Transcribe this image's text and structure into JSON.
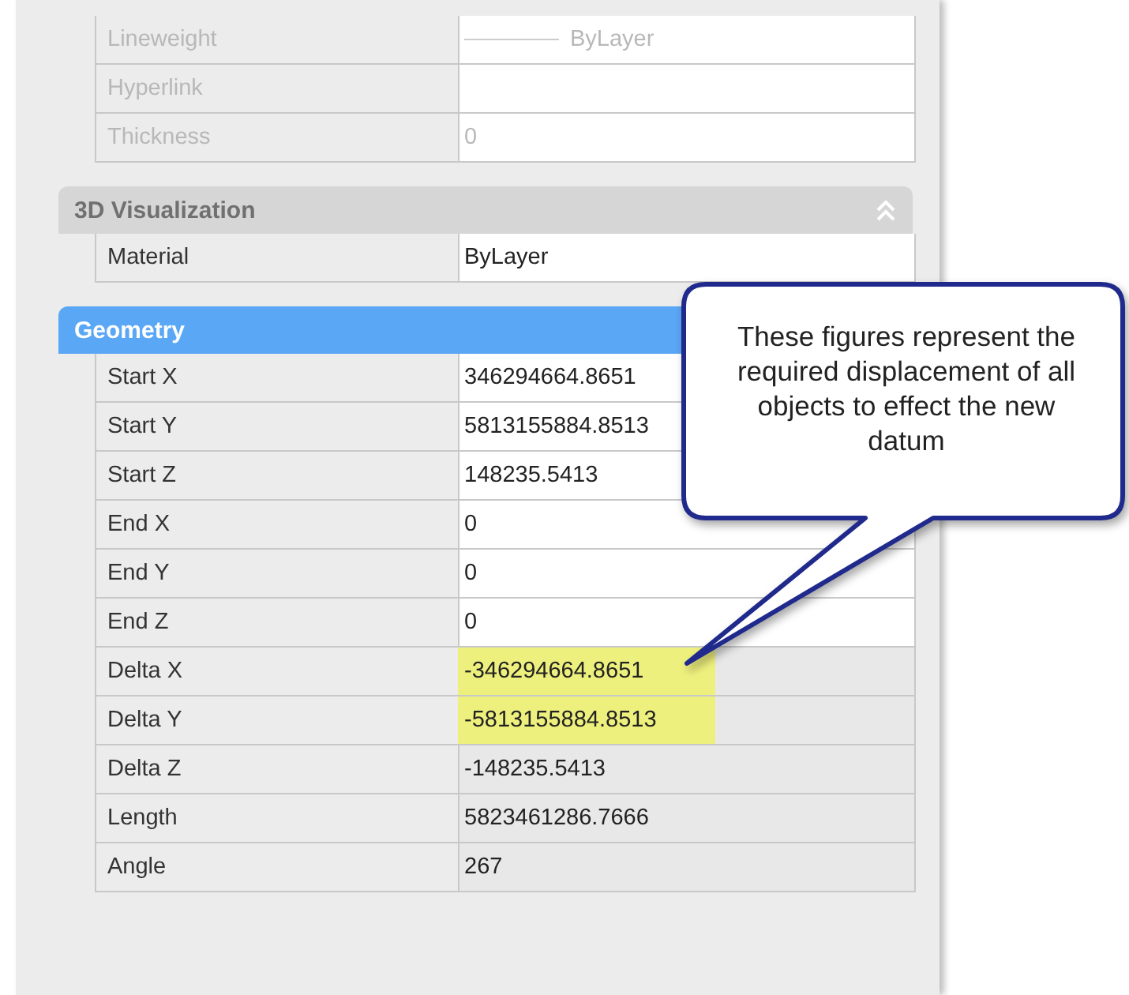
{
  "sections": [
    {
      "rows": [
        {
          "label": "Lineweight",
          "value": "ByLayer",
          "kind": "line",
          "disabled": true,
          "editable": true,
          "highlighted": false
        },
        {
          "label": "Hyperlink",
          "value": null,
          "kind": "text",
          "disabled": true,
          "editable": true,
          "highlighted": false
        },
        {
          "label": "Thickness",
          "value": "0",
          "kind": "text",
          "disabled": true,
          "editable": true,
          "highlighted": false
        }
      ]
    },
    {
      "title": "3D Visualization",
      "selected": false,
      "toggle": true,
      "rows": [
        {
          "label": "Material",
          "value": "ByLayer",
          "kind": "text",
          "disabled": false,
          "editable": true,
          "highlighted": false
        }
      ]
    },
    {
      "title": "Geometry",
      "selected": true,
      "rows": [
        {
          "label": "Start X",
          "value": "346294664.8651",
          "kind": "text",
          "disabled": false,
          "editable": true,
          "highlighted": false
        },
        {
          "label": "Start Y",
          "value": "5813155884.8513",
          "kind": "text",
          "disabled": false,
          "editable": true,
          "highlighted": false
        },
        {
          "label": "Start Z",
          "value": "148235.5413",
          "kind": "text",
          "disabled": false,
          "editable": true,
          "highlighted": false
        },
        {
          "label": "End X",
          "value": "0",
          "kind": "text",
          "disabled": false,
          "editable": true,
          "highlighted": false
        },
        {
          "label": "End Y",
          "value": "0",
          "kind": "text",
          "disabled": false,
          "editable": true,
          "highlighted": false
        },
        {
          "label": "End Z",
          "value": "0",
          "kind": "text",
          "disabled": false,
          "editable": true,
          "highlighted": false
        },
        {
          "label": "Delta X",
          "value": "-346294664.8651",
          "kind": "text",
          "disabled": false,
          "editable": false,
          "highlighted": true
        },
        {
          "label": "Delta Y",
          "value": "-5813155884.8513",
          "kind": "text",
          "disabled": false,
          "editable": false,
          "highlighted": true
        },
        {
          "label": "Delta Z",
          "value": "-148235.5413",
          "kind": "text",
          "disabled": false,
          "editable": false,
          "highlighted": false
        },
        {
          "label": "Length",
          "value": "5823461286.7666",
          "kind": "text",
          "disabled": false,
          "editable": false,
          "highlighted": false
        },
        {
          "label": "Angle",
          "value": "267",
          "kind": "text",
          "disabled": false,
          "editable": false,
          "highlighted": false
        }
      ]
    }
  ],
  "callout": {
    "text": "These figures represent the required displacement of all objects to effect the new datum"
  }
}
